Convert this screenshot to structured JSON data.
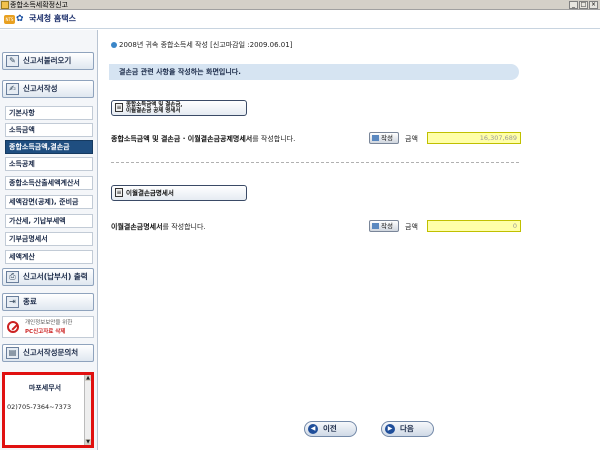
{
  "window": {
    "title": "종합소득세확정신고"
  },
  "header": {
    "logo_text": "NTS",
    "brand": "국세청 홈택스"
  },
  "sidebar": {
    "load_button": "신고서불러오기",
    "write_button": "신고서작성",
    "items": [
      "기본사항",
      "소득금액",
      "종합소득금액,결손금",
      "소득공제",
      "종합소득산출세액계산서",
      "세액감면(공제), 준비금",
      "가산세, 기납부세액",
      "기부금명세서",
      "세액계산"
    ],
    "active_index": 2,
    "print_button": "신고서(납부서) 출력",
    "exit_button": "종료",
    "warning_line1": "개인정보보안을 위한",
    "warning_line2": "PC신고자료 삭제",
    "office_button": "신고서작성문의처",
    "office_name": "마포세무서",
    "office_phone": "02)705-7364~7373"
  },
  "main": {
    "deadline": "2008년 귀속 종합소득세 작성 [신고마감일 :2009.06.01]",
    "banner": "결손금 관련 사항을 작성하는 화면입니다.",
    "section1": {
      "tag_line1": "종합소득금액 및 결손금,",
      "tag_line2": "이월결손금 공제 명세서",
      "desc_bold": "종합소득금액 및 결손금 · 이월결손금공제명세서",
      "desc_rest": "를 작성합니다.",
      "write_label": "작성",
      "amount_label": "금액",
      "amount_value": "16,307,689"
    },
    "section2": {
      "tag": "이월결손금명세서",
      "desc_bold": "이월결손금명세서",
      "desc_rest": "를 작성합니다.",
      "write_label": "작성",
      "amount_label": "금액",
      "amount_value": "0"
    }
  },
  "footer": {
    "prev": "이전",
    "next": "다음"
  }
}
